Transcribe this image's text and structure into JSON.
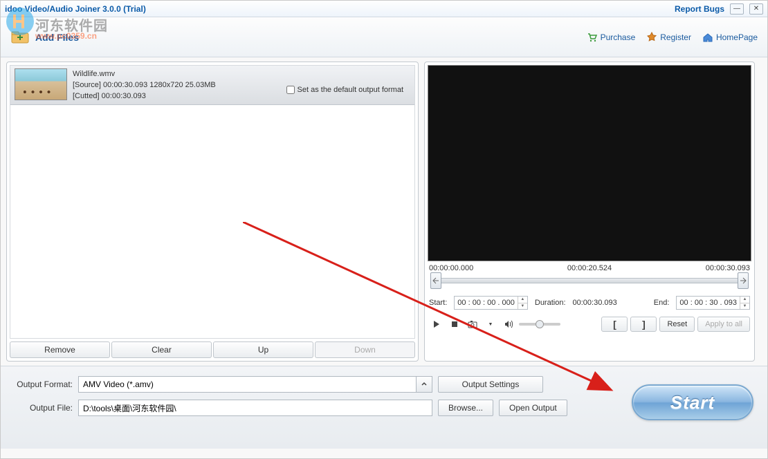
{
  "title": "idoo Video/Audio Joiner 3.0.0 (Trial)",
  "report_bugs": "Report Bugs",
  "watermark": {
    "text1": "河东软件园",
    "text2": "www.pc0359.cn"
  },
  "toolbar": {
    "add_files": "Add Files",
    "purchase": "Purchase",
    "register": "Register",
    "homepage": "HomePage"
  },
  "file": {
    "name": "Wildlife.wmv",
    "source": "[Source]  00:00:30.093  1280x720  25.03MB",
    "cutted": "[Cutted]  00:00:30.093",
    "default_format_label": "Set as the default output format"
  },
  "listbtns": {
    "remove": "Remove",
    "clear": "Clear",
    "up": "Up",
    "down": "Down"
  },
  "timeline": {
    "t0": "00:00:00.000",
    "t1": "00:00:20.524",
    "t2": "00:00:30.093"
  },
  "timectrl": {
    "start_label": "Start:",
    "start_value": "00 : 00 : 00 . 000",
    "duration_label": "Duration:",
    "duration_value": "00:00:30.093",
    "end_label": "End:",
    "end_value": "00 : 00 : 30 . 093"
  },
  "playctrl": {
    "reset": "Reset",
    "apply_all": "Apply to all"
  },
  "output": {
    "format_label": "Output Format:",
    "format_value": "AMV Video (*.amv)",
    "settings_btn": "Output Settings",
    "file_label": "Output File:",
    "file_value": "D:\\tools\\桌面\\河东软件园\\",
    "browse": "Browse...",
    "open_output": "Open Output"
  },
  "start": "Start"
}
